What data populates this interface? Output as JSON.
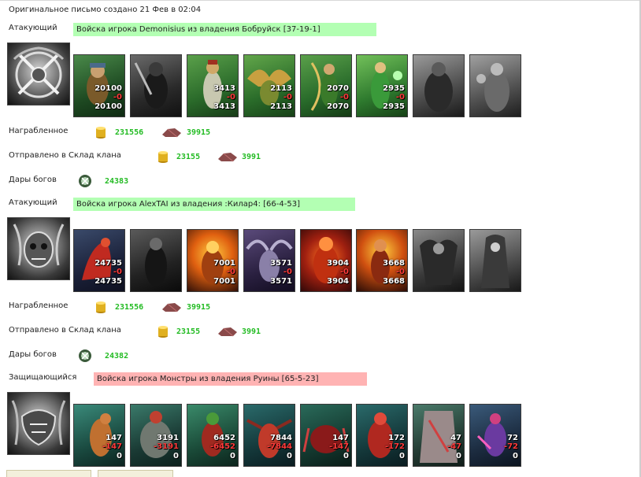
{
  "header": "Оригинальное письмо создано 21 Фев в 02:04",
  "labels": {
    "plundered": "Награбленное",
    "sent_to_warehouse": "Отправлено в Склад клана",
    "gifts_of_gods": "Дары богов"
  },
  "sections": [
    {
      "role": "Атакующий",
      "banner": "Войска игрока Demonisius из владения Бобруйск [37-19-1]",
      "banner_color": "#b3ffb3",
      "units": [
        {
          "n1": "20100",
          "n2": "-0",
          "n3": "20100"
        },
        {
          "n1": "",
          "n2": "",
          "n3": ""
        },
        {
          "n1": "3413",
          "n2": "-0",
          "n3": "3413"
        },
        {
          "n1": "2113",
          "n2": "-0",
          "n3": "2113"
        },
        {
          "n1": "2070",
          "n2": "-0",
          "n3": "2070"
        },
        {
          "n1": "2935",
          "n2": "-0",
          "n3": "2935"
        },
        {
          "n1": "",
          "n2": "",
          "n3": ""
        },
        {
          "n1": "",
          "n2": "",
          "n3": ""
        }
      ],
      "plunder": {
        "gold": "231556",
        "ore": "39915"
      },
      "warehouse": {
        "gold": "23155",
        "ore": "3991"
      },
      "gifts": "24383"
    },
    {
      "role": "Атакующий",
      "banner": "Войска игрока AlexTAI из владения :Килар4: [66-4-53]",
      "banner_color": "#b3ffb3",
      "units": [
        {
          "n1": "24735",
          "n2": "-0",
          "n3": "24735"
        },
        {
          "n1": "",
          "n2": "",
          "n3": ""
        },
        {
          "n1": "7001",
          "n2": "-0",
          "n3": "7001"
        },
        {
          "n1": "3571",
          "n2": "-0",
          "n3": "3571"
        },
        {
          "n1": "3904",
          "n2": "-0",
          "n3": "3904"
        },
        {
          "n1": "3668",
          "n2": "-0",
          "n3": "3668"
        },
        {
          "n1": "",
          "n2": "",
          "n3": ""
        },
        {
          "n1": "",
          "n2": "",
          "n3": ""
        }
      ],
      "plunder": {
        "gold": "231556",
        "ore": "39915"
      },
      "warehouse": {
        "gold": "23155",
        "ore": "3991"
      },
      "gifts": "24382"
    },
    {
      "role": "Защищающийся",
      "banner": "Войска игрока Монстры из владения Руины [65-5-23]",
      "banner_color": "#ffb3b3",
      "units": [
        {
          "n1": "147",
          "n2": "-147",
          "n3": "0"
        },
        {
          "n1": "3191",
          "n2": "-3191",
          "n3": "0"
        },
        {
          "n1": "6452",
          "n2": "-6452",
          "n3": "0"
        },
        {
          "n1": "7844",
          "n2": "-7844",
          "n3": "0"
        },
        {
          "n1": "147",
          "n2": "-147",
          "n3": "0"
        },
        {
          "n1": "172",
          "n2": "-172",
          "n3": "0"
        },
        {
          "n1": "47",
          "n2": "-47",
          "n3": "0"
        },
        {
          "n1": "72",
          "n2": "-72",
          "n3": "0"
        }
      ]
    }
  ]
}
